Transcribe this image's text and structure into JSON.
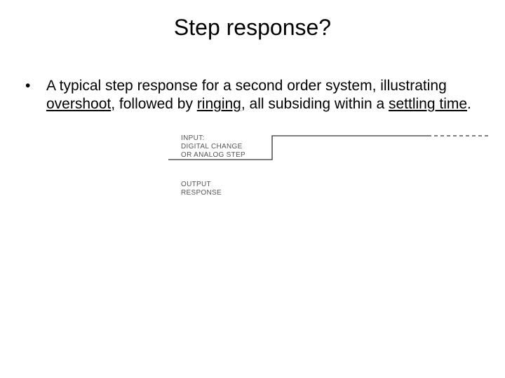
{
  "title": "Step response?",
  "bullet": {
    "pre": "A typical step response for a second order system, illustrating ",
    "overshoot": "overshoot",
    "mid1": ", followed by ",
    "ringing": "ringing",
    "mid2": ", all subsiding within a ",
    "settling": "settling time",
    "post": "."
  },
  "diagram": {
    "input_l1": "INPUT:",
    "input_l2": "DIGITAL CHANGE",
    "input_l3": "OR ANALOG STEP",
    "output_l1": "OUTPUT",
    "output_l2": "RESPONSE"
  }
}
